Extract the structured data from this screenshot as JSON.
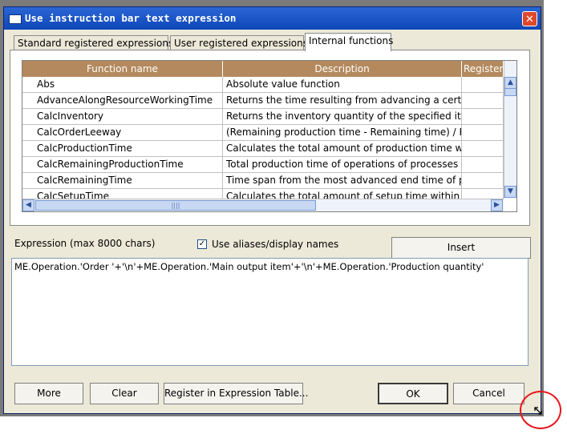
{
  "window": {
    "title": "Use instruction bar text expression",
    "close_label": "✕"
  },
  "tabs": [
    {
      "label": "Standard registered expressions"
    },
    {
      "label": "User registered expressions"
    },
    {
      "label": "Internal functions"
    }
  ],
  "table": {
    "columns": [
      "Function name",
      "Description",
      "Register"
    ],
    "rows": [
      {
        "name": "Abs",
        "desc": "Absolute value function",
        "reg": ""
      },
      {
        "name": "AdvanceAlongResourceWorkingTime",
        "desc": "Returns the time resulting from advancing a certain le",
        "reg": ""
      },
      {
        "name": "CalcInventory",
        "desc": "Returns the inventory quantity of the specified item at t",
        "reg": ""
      },
      {
        "name": "CalcOrderLeeway",
        "desc": "(Remaining production time - Remaining time) / Rem",
        "reg": ""
      },
      {
        "name": "CalcProductionTime",
        "desc": "Calculates the total amount of production time within t",
        "reg": ""
      },
      {
        "name": "CalcRemainingProductionTime",
        "desc": "Total production time of operations of processes to go",
        "reg": ""
      },
      {
        "name": "CalcRemainingTime",
        "desc": "Time span from the most advanced end time of previo",
        "reg": ""
      },
      {
        "name": "CalcSetupTime",
        "desc": "Calculates the total amount of setup time within the sp",
        "reg": ""
      }
    ],
    "scroll_up": "▲",
    "scroll_down": "▼",
    "scroll_left": "◀",
    "scroll_right": "▶",
    "thumb_grip": "||||"
  },
  "expression": {
    "label": "Expression (max 8000 chars)",
    "use_aliases_label": "Use aliases/display names",
    "use_aliases_checked": true,
    "value": "ME.Operation.'Order '+'\\n'+ME.Operation.'Main output item'+'\\n'+ME.Operation.'Production quantity'",
    "insert_label": "Insert"
  },
  "buttons": {
    "more": "More",
    "clear": "Clear",
    "register": "Register in Expression Table...",
    "ok": "OK",
    "cancel": "Cancel"
  },
  "checkmark": "✓",
  "colors": {
    "header": "#b3895d",
    "titlebar": "#0d47b8",
    "highlight_circle": "#e8141a"
  }
}
